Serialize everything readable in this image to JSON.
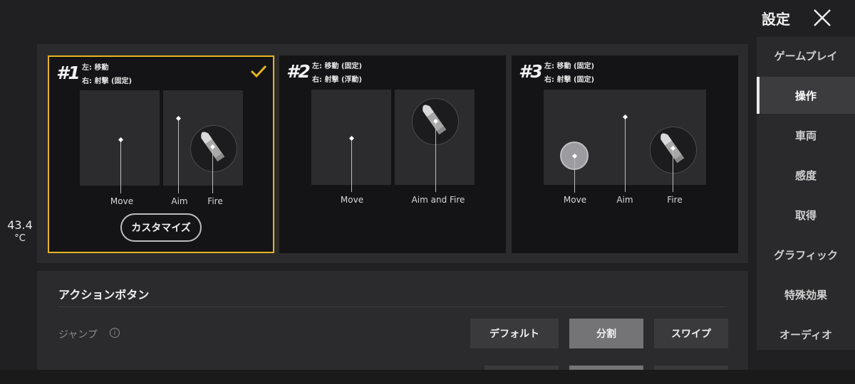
{
  "header": {
    "title": "設定"
  },
  "temperature": {
    "value": "43.4",
    "unit": "°C"
  },
  "sidebar": {
    "items": [
      {
        "label": "ゲームプレイ",
        "active": false
      },
      {
        "label": "操作",
        "active": true
      },
      {
        "label": "車両",
        "active": false
      },
      {
        "label": "感度",
        "active": false
      },
      {
        "label": "取得",
        "active": false
      },
      {
        "label": "グラフィック",
        "active": false
      },
      {
        "label": "特殊効果",
        "active": false
      },
      {
        "label": "オーディオ",
        "active": false
      }
    ]
  },
  "layouts": [
    {
      "number": "#1",
      "line1": "左: 移動",
      "line2": "右: 射撃 (固定)",
      "selected": true,
      "labels": {
        "move": "Move",
        "aim": "Aim",
        "fire": "Fire"
      },
      "customize_label": "カスタマイズ"
    },
    {
      "number": "#2",
      "line1": "左: 移動 (固定)",
      "line2": "右: 射撃 (浮動)",
      "selected": false,
      "labels": {
        "move": "Move",
        "aim_fire": "Aim and Fire"
      }
    },
    {
      "number": "#3",
      "line1": "左: 移動 (固定)",
      "line2": "右: 射撃 (固定)",
      "selected": false,
      "labels": {
        "move": "Move",
        "aim": "Aim",
        "fire": "Fire"
      }
    }
  ],
  "action_buttons": {
    "title": "アクションボタン",
    "jump": {
      "label": "ジャンプ",
      "info": "i",
      "options": [
        "デフォルト",
        "分割",
        "スワイプ"
      ],
      "selected": "分割"
    }
  },
  "colors": {
    "accent": "#e6b422",
    "selected_option": "#747476"
  }
}
